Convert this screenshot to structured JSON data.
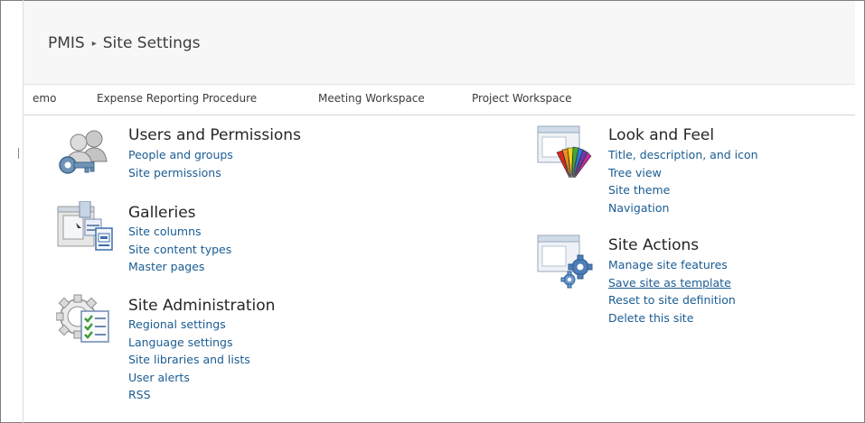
{
  "header": {
    "site_name": "PMIS",
    "separator": "▸",
    "page_title": "Site Settings"
  },
  "topnav": {
    "items": [
      "emo",
      "Expense Reporting Procedure",
      "Meeting Workspace",
      "Project Workspace"
    ]
  },
  "sections": {
    "users": {
      "title": "Users and Permissions",
      "icon": "users-permissions-icon",
      "links": [
        "People and groups",
        "Site permissions"
      ]
    },
    "galleries": {
      "title": "Galleries",
      "icon": "galleries-icon",
      "links": [
        "Site columns",
        "Site content types",
        "Master pages"
      ]
    },
    "admin": {
      "title": "Site Administration",
      "icon": "site-administration-icon",
      "links": [
        "Regional settings",
        "Language settings",
        "Site libraries and lists",
        "User alerts",
        "RSS"
      ]
    },
    "look": {
      "title": "Look and Feel",
      "icon": "look-and-feel-icon",
      "links": [
        "Title, description, and icon",
        "Tree view",
        "Site theme",
        "Navigation"
      ]
    },
    "actions": {
      "title": "Site Actions",
      "icon": "site-actions-icon",
      "links": [
        "Manage site features",
        "Save site as template",
        "Reset to site definition",
        "Delete this site"
      ]
    }
  },
  "colors": {
    "link": "#1a5c93",
    "title": "#262626",
    "header_bg": "#f7f7f7"
  }
}
